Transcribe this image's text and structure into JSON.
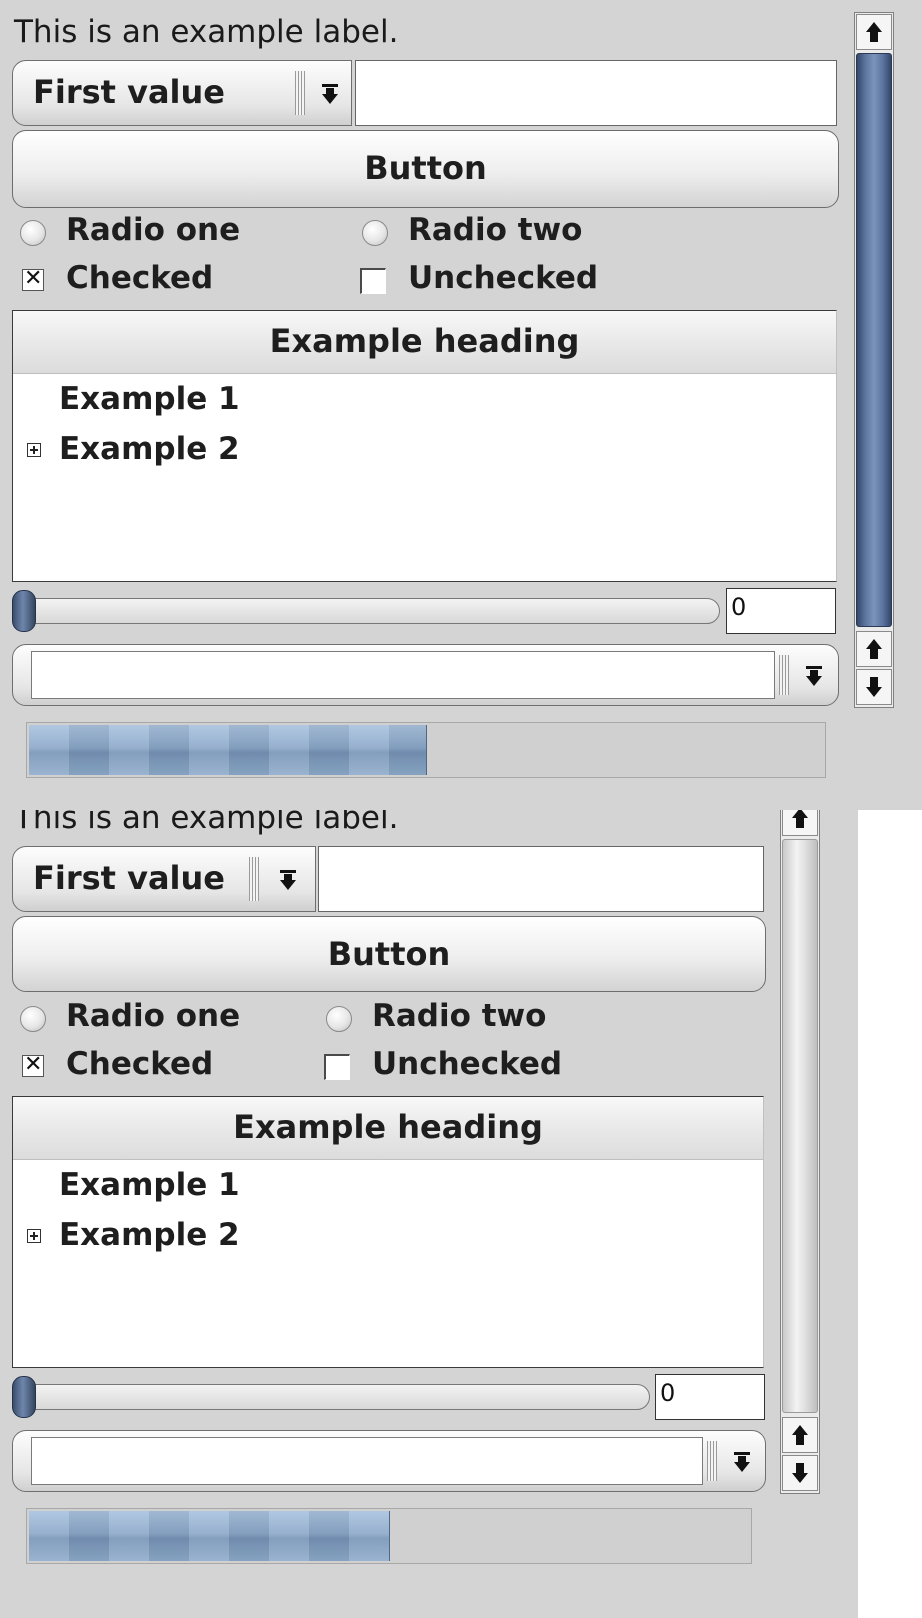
{
  "panels": [
    {
      "label": "This is an example label.",
      "combo": {
        "selected": "First value"
      },
      "text_field": {
        "value": ""
      },
      "button": {
        "label": "Button"
      },
      "radios": [
        {
          "label": "Radio one",
          "checked": false
        },
        {
          "label": "Radio two",
          "checked": false
        }
      ],
      "checkboxes": [
        {
          "label": "Checked",
          "checked": true
        },
        {
          "label": "Unchecked",
          "checked": false
        }
      ],
      "tree": {
        "heading": "Example heading",
        "items": [
          {
            "label": "Example 1",
            "expandable": false
          },
          {
            "label": "Example 2",
            "expandable": true
          }
        ]
      },
      "slider": {
        "value": 0
      },
      "spin_value": "0",
      "editable_combo": {
        "value": ""
      },
      "progress": {
        "value": 0.5
      },
      "scrollbar": {
        "state": "active"
      }
    },
    {
      "label": "This is an example label.",
      "combo": {
        "selected": "First value"
      },
      "text_field": {
        "value": ""
      },
      "button": {
        "label": "Button"
      },
      "radios": [
        {
          "label": "Radio one",
          "checked": false
        },
        {
          "label": "Radio two",
          "checked": false
        }
      ],
      "checkboxes": [
        {
          "label": "Checked",
          "checked": true
        },
        {
          "label": "Unchecked",
          "checked": false
        }
      ],
      "tree": {
        "heading": "Example heading",
        "items": [
          {
            "label": "Example 1",
            "expandable": false
          },
          {
            "label": "Example 2",
            "expandable": true
          }
        ]
      },
      "slider": {
        "value": 0
      },
      "spin_value": "0",
      "editable_combo": {
        "value": ""
      },
      "progress": {
        "value": 0.5
      },
      "scrollbar": {
        "state": "inactive"
      }
    }
  ],
  "colors": {
    "window_bg": "#d4d4d4",
    "accent": "#6f86ac",
    "progress_fill": "#8aa7c8"
  },
  "icons": {
    "combo_arrow": "dropdown-arrow-icon",
    "tree_expander": "plus-box-icon",
    "scroll_up": "arrow-up-icon",
    "scroll_down": "arrow-down-icon"
  }
}
